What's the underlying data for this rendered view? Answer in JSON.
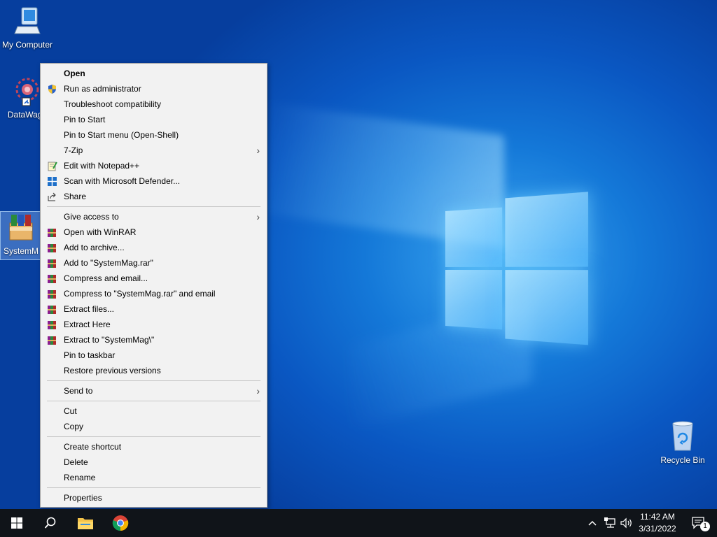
{
  "desktop": {
    "icons": [
      {
        "label": "My Computer",
        "icon": "computer-icon"
      },
      {
        "label": "DataWago",
        "icon": "datawago-app-icon"
      },
      {
        "label": "SystemM",
        "icon": "winrar-archive-icon"
      },
      {
        "label": "Recycle Bin",
        "icon": "recycle-bin-icon"
      }
    ]
  },
  "context_menu": {
    "items": [
      {
        "label": "Open",
        "bold": true
      },
      {
        "label": "Run as administrator",
        "icon": "uac-shield-icon"
      },
      {
        "label": "Troubleshoot compatibility"
      },
      {
        "label": "Pin to Start"
      },
      {
        "label": "Pin to Start menu (Open-Shell)"
      },
      {
        "label": "7-Zip",
        "submenu": true
      },
      {
        "label": "Edit with Notepad++",
        "icon": "notepad-plus-plus-icon"
      },
      {
        "label": "Scan with Microsoft Defender...",
        "icon": "defender-icon"
      },
      {
        "label": "Share",
        "icon": "share-icon"
      },
      {
        "label": "Give access to",
        "submenu": true
      },
      {
        "label": "Open with WinRAR",
        "icon": "winrar-icon"
      },
      {
        "label": "Add to archive...",
        "icon": "winrar-icon"
      },
      {
        "label": "Add to \"SystemMag.rar\"",
        "icon": "winrar-icon"
      },
      {
        "label": "Compress and email...",
        "icon": "winrar-icon"
      },
      {
        "label": "Compress to \"SystemMag.rar\" and email",
        "icon": "winrar-icon"
      },
      {
        "label": "Extract files...",
        "icon": "winrar-icon"
      },
      {
        "label": "Extract Here",
        "icon": "winrar-icon"
      },
      {
        "label": "Extract to \"SystemMag\\\"",
        "icon": "winrar-icon"
      },
      {
        "label": "Pin to taskbar"
      },
      {
        "label": "Restore previous versions"
      },
      {
        "label": "Send to",
        "submenu": true
      },
      {
        "label": "Cut"
      },
      {
        "label": "Copy"
      },
      {
        "label": "Create shortcut"
      },
      {
        "label": "Delete"
      },
      {
        "label": "Rename"
      },
      {
        "label": "Properties"
      }
    ],
    "submenu_arrow": "›"
  },
  "taskbar": {
    "start_icon": "windows-start-icon",
    "search_icon": "search-icon",
    "pinned": [
      {
        "name": "file-explorer-icon"
      },
      {
        "name": "chrome-icon"
      }
    ],
    "tray": {
      "chevron": "^",
      "network_icon": "network-icon",
      "volume_icon": "volume-icon",
      "time": "11:42 AM",
      "date": "3/31/2022",
      "notification_icon": "action-center-icon",
      "notification_count": "1"
    }
  },
  "colors": {
    "menu_bg": "#f2f2f2",
    "taskbar_bg": "#101419",
    "desktop_blue": "#0a57c2"
  }
}
